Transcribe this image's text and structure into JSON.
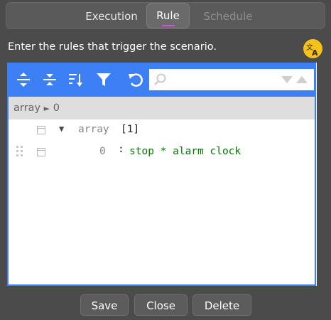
{
  "tabs": [
    {
      "label": "Execution"
    },
    {
      "label": "Rule"
    },
    {
      "label": "Schedule"
    }
  ],
  "prompt": "Enter the rules that trigger the scenario.",
  "colors": {
    "accent": "#3d7ff5",
    "active_tab_indicator": "#d94fd9",
    "translate_badge": "#f5c21b",
    "value_text": "#007a00",
    "index_text": "#888888"
  },
  "toolbar_icons": [
    "expand-all-icon",
    "collapse-all-icon",
    "sort-icon",
    "filter-icon",
    "undo-icon",
    "search-icon",
    "search-next-icon",
    "search-previous-icon"
  ],
  "search": {
    "placeholder": ""
  },
  "breadcrumb": {
    "root": "array",
    "separator": "►",
    "node": "0"
  },
  "tree": {
    "root_label": "array",
    "root_count": "[1]",
    "items": [
      {
        "index": "0",
        "separator": ":",
        "value": "stop * alarm clock"
      }
    ]
  },
  "buttons": {
    "save": "Save",
    "close": "Close",
    "delete": "Delete"
  }
}
